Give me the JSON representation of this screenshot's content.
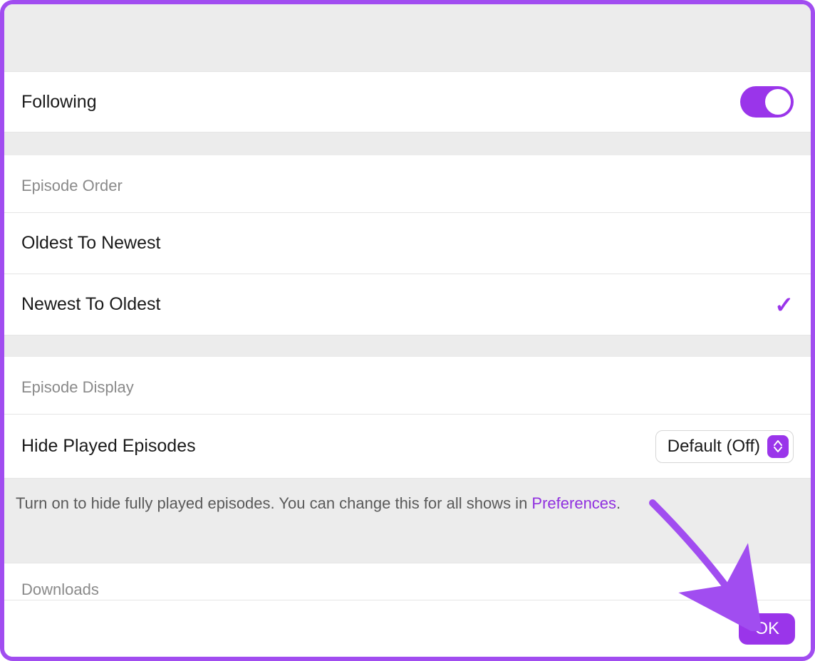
{
  "following": {
    "label": "Following",
    "enabled": true
  },
  "episode_order": {
    "header": "Episode Order",
    "options": [
      {
        "label": "Oldest To Newest",
        "selected": false
      },
      {
        "label": "Newest To Oldest",
        "selected": true
      }
    ]
  },
  "episode_display": {
    "header": "Episode Display",
    "hide_played_label": "Hide Played Episodes",
    "hide_played_value": "Default (Off)",
    "description_prefix": "Turn on to hide fully played episodes. You can change this for all shows in ",
    "description_link": "Preferences",
    "description_suffix": "."
  },
  "downloads": {
    "header": "Downloads"
  },
  "footer": {
    "ok_label": "OK"
  }
}
